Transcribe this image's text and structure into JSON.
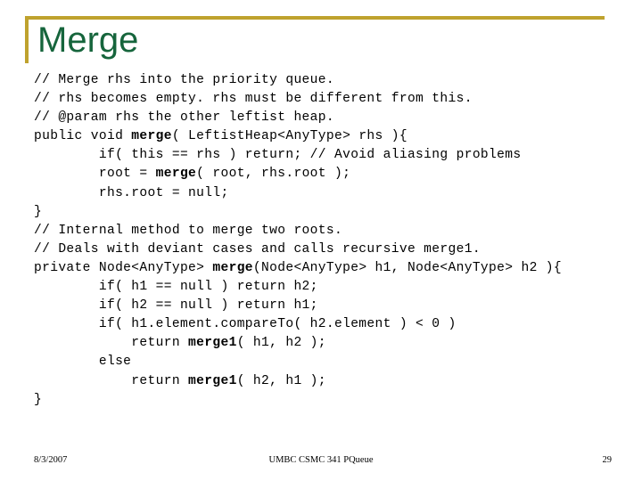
{
  "slide": {
    "title": "Merge",
    "accent_color": "#BFA22E",
    "title_color": "#16653C",
    "background_color": "#FFFFFF"
  },
  "code": {
    "language": "java",
    "lines": [
      {
        "id": "l1",
        "text": "// Merge rhs into the priority queue."
      },
      {
        "id": "l2",
        "text": "// rhs becomes empty. rhs must be different from this."
      },
      {
        "id": "l3",
        "text": "// @param rhs the other leftist heap."
      },
      {
        "id": "l4",
        "pre": "public void ",
        "bold": "merge",
        "post": "( LeftistHeap<AnyType> rhs ){"
      },
      {
        "id": "l5",
        "text": "        if( this == rhs ) return; // Avoid aliasing problems"
      },
      {
        "id": "l6",
        "pre": "        root = ",
        "bold": "merge",
        "post": "( root, rhs.root );"
      },
      {
        "id": "l7",
        "text": "        rhs.root = null;"
      },
      {
        "id": "l8",
        "text": "}"
      },
      {
        "id": "l9",
        "text": "// Internal method to merge two roots."
      },
      {
        "id": "l10",
        "text": "// Deals with deviant cases and calls recursive merge1."
      },
      {
        "id": "l11",
        "pre": "private Node<AnyType> ",
        "bold": "merge",
        "post": "(Node<AnyType> h1, Node<AnyType> h2 ){"
      },
      {
        "id": "l12",
        "text": "        if( h1 == null ) return h2;"
      },
      {
        "id": "l13",
        "text": "        if( h2 == null ) return h1;"
      },
      {
        "id": "l14",
        "text": "        if( h1.element.compareTo( h2.element ) < 0 )"
      },
      {
        "id": "l15",
        "pre": "            return ",
        "bold": "merge1",
        "post": "( h1, h2 );"
      },
      {
        "id": "l16",
        "text": "        else"
      },
      {
        "id": "l17",
        "pre": "            return ",
        "bold": "merge1",
        "post": "( h2, h1 );"
      },
      {
        "id": "l18",
        "text": "}"
      }
    ]
  },
  "footer": {
    "date": "8/3/2007",
    "center": "UMBC CSMC 341 PQueue",
    "page_number": "29"
  }
}
